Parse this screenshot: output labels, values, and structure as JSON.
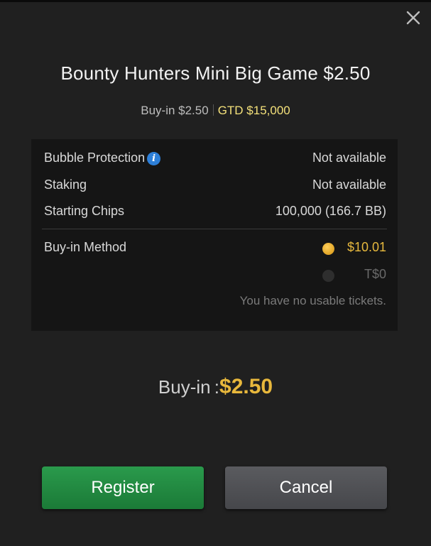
{
  "dialog": {
    "title": "Bounty Hunters Mini Big Game $2.50",
    "subtitle": {
      "buyin": "Buy-in $2.50",
      "gtd": "GTD $15,000"
    },
    "close_icon": "close-icon"
  },
  "details": {
    "bubble_protection": {
      "label": "Bubble Protection",
      "info_icon": "i",
      "value": "Not available"
    },
    "staking": {
      "label": "Staking",
      "value": "Not available"
    },
    "starting_chips": {
      "label": "Starting Chips",
      "value": "100,000 (166.7 BB)"
    },
    "buyin_method": {
      "label": "Buy-in Method",
      "options": [
        {
          "value": "$10.01",
          "selected": true
        },
        {
          "value": "T$0",
          "selected": false
        }
      ],
      "note": "You have no usable tickets."
    }
  },
  "total": {
    "label": "Buy-in :",
    "amount": "$2.50"
  },
  "buttons": {
    "register": "Register",
    "cancel": "Cancel"
  },
  "colors": {
    "accent_gold": "#e8b83c",
    "gtd_yellow": "#f3e07a",
    "register_green": "#1f8a3f",
    "cancel_gray": "#505155",
    "info_blue": "#2d7fd8"
  }
}
